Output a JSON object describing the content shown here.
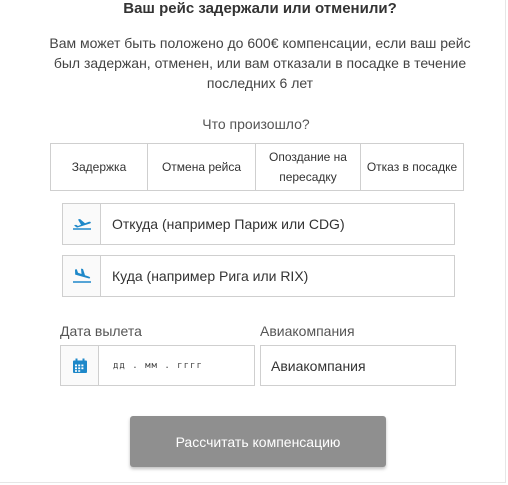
{
  "header": {
    "title": "Ваш рейс задержали или отменили?",
    "subtitle": "Вам может быть положено до 600€ компенсации, если ваш рейс был задержан, отменен, или вам отказали в посадке в течение последних 6 лет"
  },
  "question": {
    "label": "Что произошло?",
    "options": [
      {
        "label": "Задержка"
      },
      {
        "label": "Отмена рейса"
      },
      {
        "label": "Опоздание на пересадку"
      },
      {
        "label": "Отказ в посадке"
      }
    ]
  },
  "from": {
    "placeholder": "Откуда (например Париж или CDG)",
    "icon": "plane-takeoff-icon"
  },
  "to": {
    "placeholder": "Куда (например Рига или RIX)",
    "icon": "plane-landing-icon"
  },
  "date": {
    "label": "Дата вылета",
    "placeholder": "дд . мм . гггг",
    "icon": "calendar-icon"
  },
  "airline": {
    "label": "Авиакомпания",
    "placeholder": "Авиакомпания"
  },
  "submit": {
    "label": "Рассчитать компенсацию"
  },
  "colors": {
    "accent": "#1e88c9",
    "button": "#8f8f8f",
    "border": "#cfcfcf"
  }
}
